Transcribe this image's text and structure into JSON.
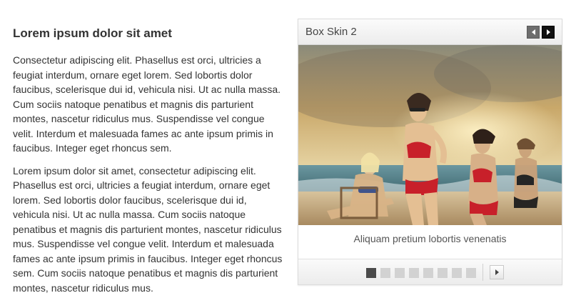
{
  "article": {
    "title": "Lorem ipsum dolor sit amet",
    "paragraphs": [
      "Consectetur adipiscing elit. Phasellus est orci, ultricies a feugiat interdum, ornare eget lorem. Sed lobortis dolor faucibus, scelerisque dui id, vehicula nisi. Ut ac nulla massa. Cum sociis natoque penatibus et magnis dis parturient montes, nascetur ridiculus mus. Suspendisse vel congue velit. Interdum et malesuada fames ac ante ipsum primis in faucibus. Integer eget rhoncus sem.",
      "Lorem ipsum dolor sit amet, consectetur adipiscing elit. Phasellus est orci, ultricies a feugiat interdum, ornare eget lorem. Sed lobortis dolor faucibus, scelerisque dui id, vehicula nisi. Ut ac nulla massa. Cum sociis natoque penatibus et magnis dis parturient montes, nascetur ridiculus mus. Suspendisse vel congue velit. Interdum et malesuada fames ac ante ipsum primis in faucibus. Integer eget rhoncus sem. Cum sociis natoque penatibus et magnis dis parturient montes, nascetur ridiculus mus."
    ]
  },
  "slider": {
    "title": "Box Skin 2",
    "caption": "Aliquam pretium lobortis venenatis",
    "slide_count": 8,
    "active_slide": 1,
    "icons": {
      "prev": "chevron-left-icon",
      "next": "chevron-right-icon"
    },
    "colors": {
      "sky": "#c9a86a",
      "sea": "#5f8a92",
      "sand": "#d8c39c",
      "swimsuit": "#c8202a",
      "active_dot": "#4b4b4b",
      "inactive_dot": "#d2d2d2"
    }
  }
}
